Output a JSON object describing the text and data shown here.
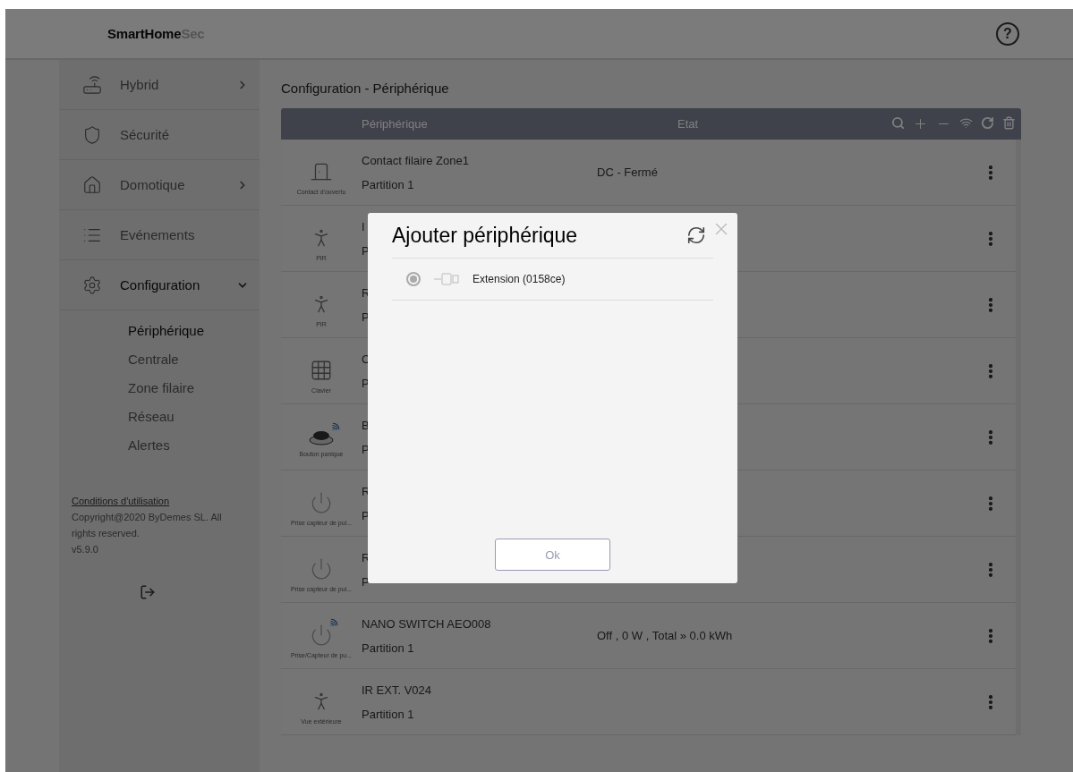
{
  "header": {
    "logo_main": "SmartHome",
    "logo_accent": "Sec",
    "help": "?"
  },
  "sidebar": {
    "items": [
      {
        "label": "Hybrid",
        "kind": "hybrid",
        "expandable": true,
        "expanded": false,
        "selected": false
      },
      {
        "label": "Sécurité",
        "kind": "shield",
        "expandable": false,
        "selected": false
      },
      {
        "label": "Domotique",
        "kind": "home",
        "expandable": true,
        "expanded": false,
        "selected": false
      },
      {
        "label": "Evénements",
        "kind": "list",
        "expandable": false,
        "selected": false
      },
      {
        "label": "Configuration",
        "kind": "gear",
        "expandable": true,
        "expanded": true,
        "selected": true
      }
    ],
    "subitems": [
      {
        "label": "Périphérique",
        "selected": true
      },
      {
        "label": "Centrale",
        "selected": false
      },
      {
        "label": "Zone filaire",
        "selected": false
      },
      {
        "label": "Réseau",
        "selected": false
      },
      {
        "label": "Alertes",
        "selected": false
      }
    ],
    "footer": {
      "terms_link": "Conditions d'utilisation",
      "copyright": "Copyright@2020 ByDemes SL. All rights reserved.",
      "version": "v5.9.0"
    }
  },
  "main": {
    "title": "Configuration - Périphérique",
    "table": {
      "columns": [
        "Périphérique",
        "Etat"
      ],
      "rows": [
        {
          "kind": "door",
          "type_label": "Contact d'ouvertu",
          "name": "Contact filaire Zone1",
          "partition": "Partition 1",
          "state": "DC - Fermé"
        },
        {
          "kind": "pir",
          "type_label": "PIR",
          "name": "I",
          "partition": "P"
        },
        {
          "kind": "pir",
          "type_label": "PIR",
          "name": "R",
          "partition": "P"
        },
        {
          "kind": "keypad",
          "type_label": "Clavier",
          "name": "C",
          "partition": "P"
        },
        {
          "kind": "panic",
          "type_label": "Bouton panique",
          "name": "B",
          "partition": "P"
        },
        {
          "kind": "plug",
          "type_label": "Prise capteur de pui...",
          "name": "R",
          "partition": "P"
        },
        {
          "kind": "plug",
          "type_label": "Prise capteur de pui...",
          "name": "R",
          "partition": "P"
        },
        {
          "kind": "plug-wireless",
          "type_label": "Prise/Capteur de pu...",
          "name": "NANO SWITCH AEO008",
          "partition": "Partition 1",
          "state": "Off , 0 W , Total » 0.0 kWh"
        },
        {
          "kind": "outdoor",
          "type_label": "Vue extérieure",
          "name": "IR EXT. V024",
          "partition": "Partition 1"
        }
      ]
    }
  },
  "dialog": {
    "title": "Ajouter périphérique",
    "items": [
      {
        "label": "Extension (0158ce)",
        "selected": true
      }
    ],
    "ok": "Ok"
  }
}
